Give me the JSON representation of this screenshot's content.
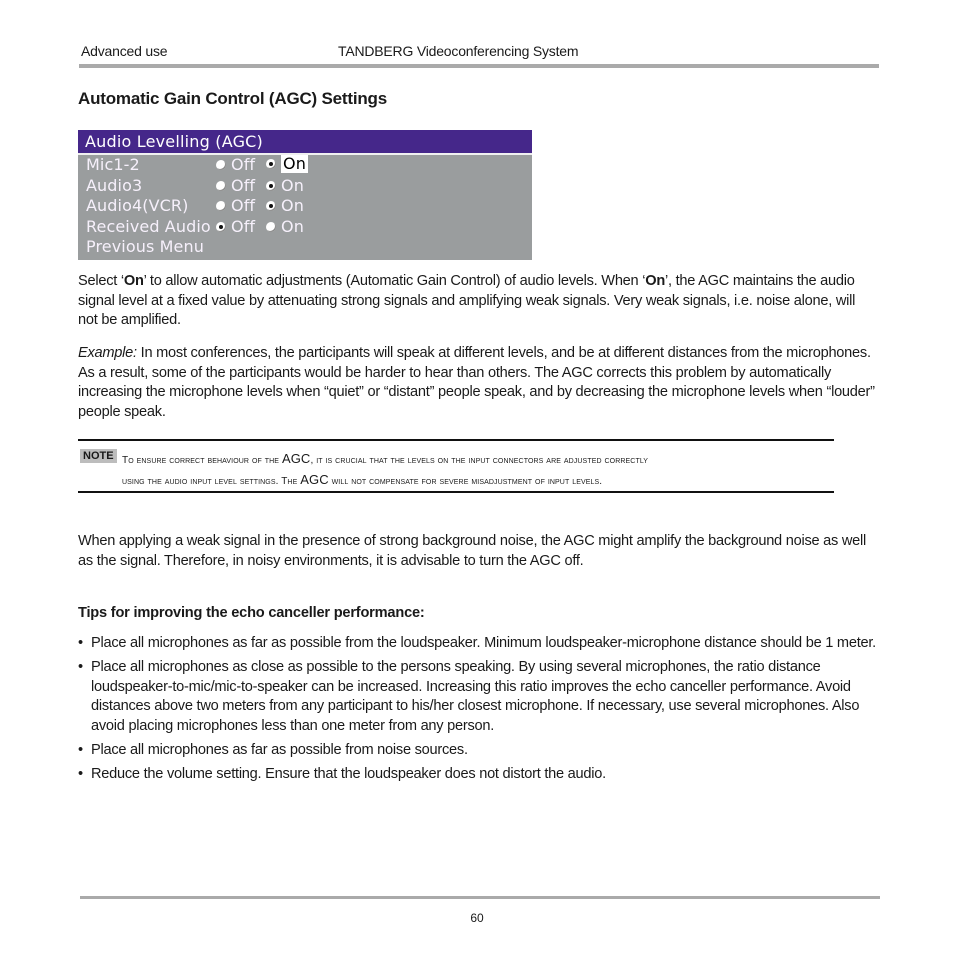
{
  "header": {
    "section": "Advanced use",
    "product": "TANDBERG Videoconferencing System"
  },
  "title": "Automatic Gain Control (AGC) Settings",
  "osd_menu": {
    "title": "Audio Levelling (AGC)",
    "off_label": "Off",
    "on_label": "On",
    "rows": [
      {
        "label": "Mic1-2",
        "selected": "On",
        "focused": true
      },
      {
        "label": "Audio3",
        "selected": "On",
        "focused": false
      },
      {
        "label": "Audio4(VCR)",
        "selected": "On",
        "focused": false
      },
      {
        "label": "Received Audio",
        "selected": "Off",
        "focused": false
      }
    ],
    "previous_menu": "Previous Menu",
    "colors": {
      "title_bar": "#45278a",
      "background": "#9a9d9e",
      "text": "#f6f0fb"
    }
  },
  "paragraph1": {
    "t1": "Select ‘",
    "b1": "On",
    "t2": "’ to allow automatic adjustments (Automatic Gain Control) of audio levels. When ‘",
    "b2": "On",
    "t3": "’, the AGC maintains the audio signal level at a fixed value by attenuating strong signals and amplifying weak signals. Very weak signals, i.e. noise alone, will not be amplified."
  },
  "paragraph2": {
    "lead": "Example:",
    "text": " In most conferences, the participants will speak at different levels, and be at different distances from the microphones. As a result, some of the participants would be harder to hear than others. The AGC corrects this problem by automatically increasing the microphone levels when “quiet” or “distant” people speak, and by decreasing the microphone levels when “louder” people speak."
  },
  "note": {
    "badge": "NOTE",
    "line1a": "To ensure correct behaviour of the ",
    "agc": "AGC",
    "line1b": ", it is crucial that the levels on the input connectors are adjusted correctly",
    "line2a": "using the audio input level settings. The ",
    "line2b": " will not compensate for severe misadjustment of input levels."
  },
  "paragraph3": "When applying a weak signal in the presence of strong background noise, the AGC might amplify the background noise as well as the signal. Therefore, in noisy environments, it is advisable to turn the AGC off.",
  "tips": {
    "title": "Tips for improving the echo canceller performance:",
    "bullet": "•",
    "items": [
      "Place all microphones as far as possible from the loudspeaker. Minimum loudspeaker-microphone distance should be 1 meter.",
      "Place all microphones as close as possible to the persons speaking. By using several microphones, the ratio distance loudspeaker-to-mic/mic-to-speaker can be increased. Increasing this ratio improves the echo canceller performance. Avoid distances above two meters from any participant to his/her closest microphone. If necessary, use several microphones. Also avoid placing microphones less than one meter from any person.",
      "Place all microphones as far as possible from noise sources.",
      "Reduce the volume setting. Ensure that the loudspeaker does not distort the audio."
    ]
  },
  "footer": {
    "page_number": "60"
  }
}
